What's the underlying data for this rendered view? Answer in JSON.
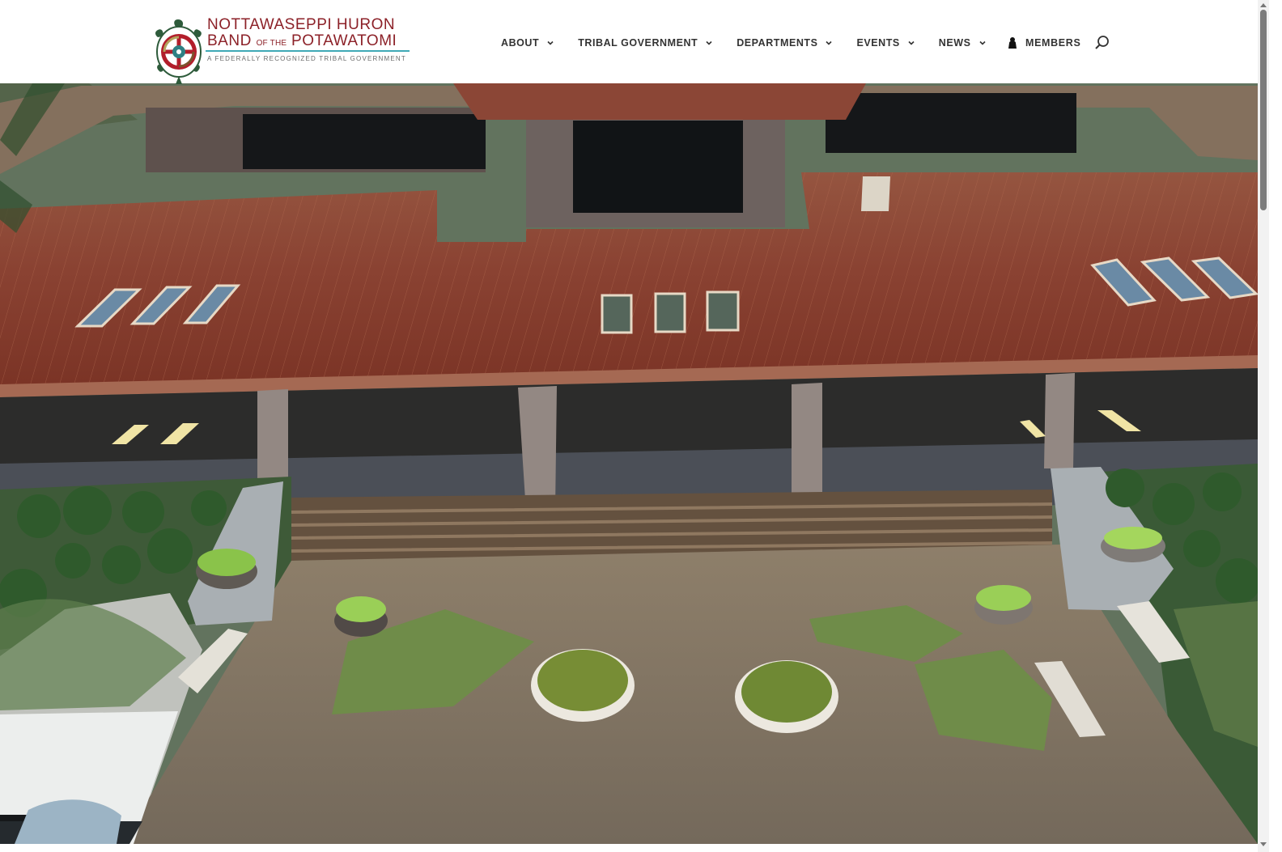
{
  "org": {
    "name_line1": "NOTTAWASEPPI HURON",
    "name_line2_a": "BAND",
    "name_line2_small": "OF THE",
    "name_line2_b": "POTAWATOMI",
    "tagline": "A FEDERALLY RECOGNIZED TRIBAL GOVERNMENT",
    "brand_color": "#8c2128",
    "accent_color": "#3fa9b6",
    "logo_icon": "turtle-emblem-icon"
  },
  "nav": {
    "items": [
      {
        "label": "ABOUT",
        "icon": "chevron-down-icon"
      },
      {
        "label": "TRIBAL GOVERNMENT",
        "icon": "chevron-down-icon"
      },
      {
        "label": "DEPARTMENTS",
        "icon": "chevron-down-icon"
      },
      {
        "label": "EVENTS",
        "icon": "chevron-down-icon"
      },
      {
        "label": "NEWS",
        "icon": "chevron-down-icon"
      }
    ],
    "members_label": "MEMBERS",
    "members_icon": "person-icon",
    "search_icon": "search-icon"
  },
  "accessibility": {
    "icon": "accessibility-icon",
    "color": "#0d47a1"
  },
  "hero": {
    "subject": "aerial view of tribal government building entrance"
  }
}
